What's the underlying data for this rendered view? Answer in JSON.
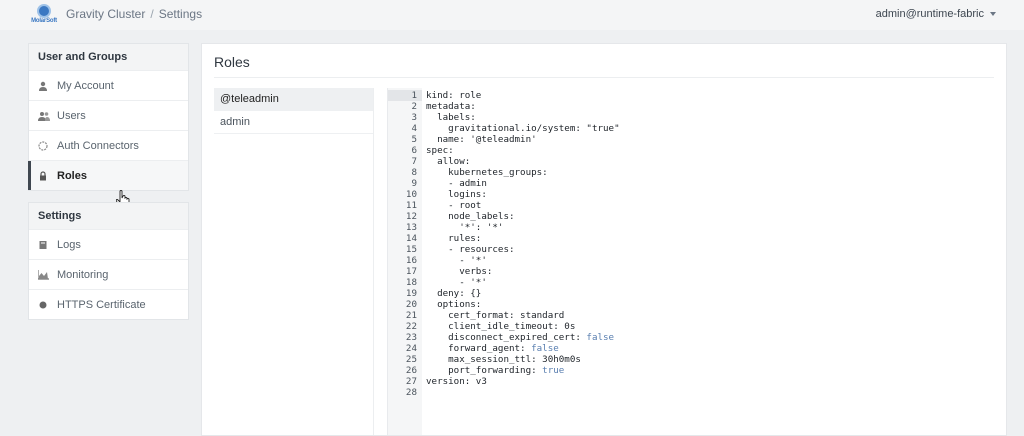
{
  "topbar": {
    "logo_text": "MolarSoft",
    "breadcrumb": [
      "Gravity Cluster",
      "Settings"
    ],
    "breadcrumb_sep": "/",
    "user": "admin@runtime-fabric"
  },
  "sidebar": {
    "group1": {
      "title": "User and Groups",
      "items": [
        {
          "label": "My Account",
          "icon": "user-icon"
        },
        {
          "label": "Users",
          "icon": "users-icon"
        },
        {
          "label": "Auth Connectors",
          "icon": "connector-icon"
        },
        {
          "label": "Roles",
          "icon": "lock-icon",
          "active": true
        }
      ]
    },
    "group2": {
      "title": "Settings",
      "items": [
        {
          "label": "Logs",
          "icon": "book-icon"
        },
        {
          "label": "Monitoring",
          "icon": "chart-icon"
        },
        {
          "label": "HTTPS Certificate",
          "icon": "circle-icon"
        }
      ]
    }
  },
  "main": {
    "title": "Roles",
    "roles": [
      "@teleadmin",
      "admin"
    ],
    "selected_role": "@teleadmin",
    "code": [
      "kind: role",
      "metadata:",
      "  labels:",
      "    gravitational.io/system: \"true\"",
      "  name: '@teleadmin'",
      "spec:",
      "  allow:",
      "    kubernetes_groups:",
      "    - admin",
      "    logins:",
      "    - root",
      "    node_labels:",
      "      '*': '*'",
      "    rules:",
      "    - resources:",
      "      - '*'",
      "      verbs:",
      "      - '*'",
      "  deny: {}",
      "  options:",
      "    cert_format: standard",
      "    client_idle_timeout: 0s",
      "    disconnect_expired_cert: false",
      "    forward_agent: false",
      "    max_session_ttl: 30h0m0s",
      "    port_forwarding: true",
      "version: v3",
      ""
    ]
  }
}
